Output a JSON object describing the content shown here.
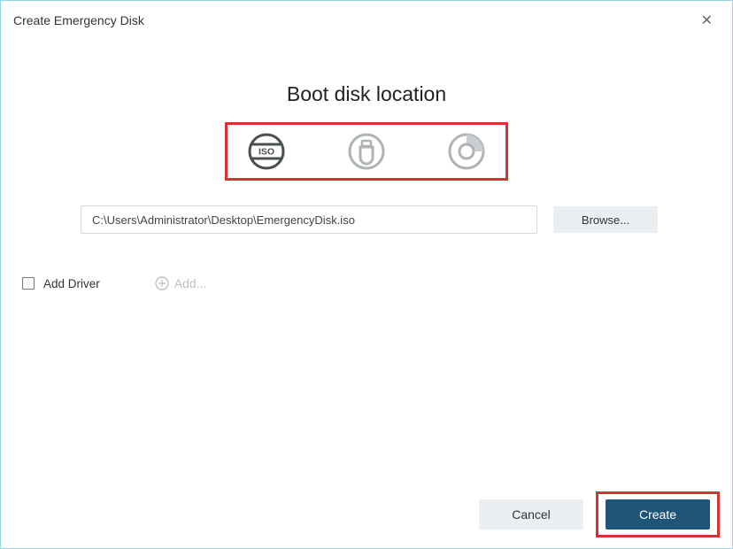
{
  "window": {
    "title": "Create Emergency Disk"
  },
  "heading": "Boot disk location",
  "disk_types": {
    "iso": "iso-icon",
    "usb": "usb-icon",
    "cd": "cd-icon"
  },
  "path_input": {
    "value": "C:\\Users\\Administrator\\Desktop\\EmergencyDisk.iso"
  },
  "browse_label": "Browse...",
  "driver": {
    "checkbox_label": "Add Driver",
    "add_label": "Add..."
  },
  "footer": {
    "cancel_label": "Cancel",
    "create_label": "Create"
  },
  "colors": {
    "accent": "#1e5578",
    "highlight_border": "#d43131",
    "window_border": "#97d5e6",
    "muted": "#bfbfbf"
  }
}
